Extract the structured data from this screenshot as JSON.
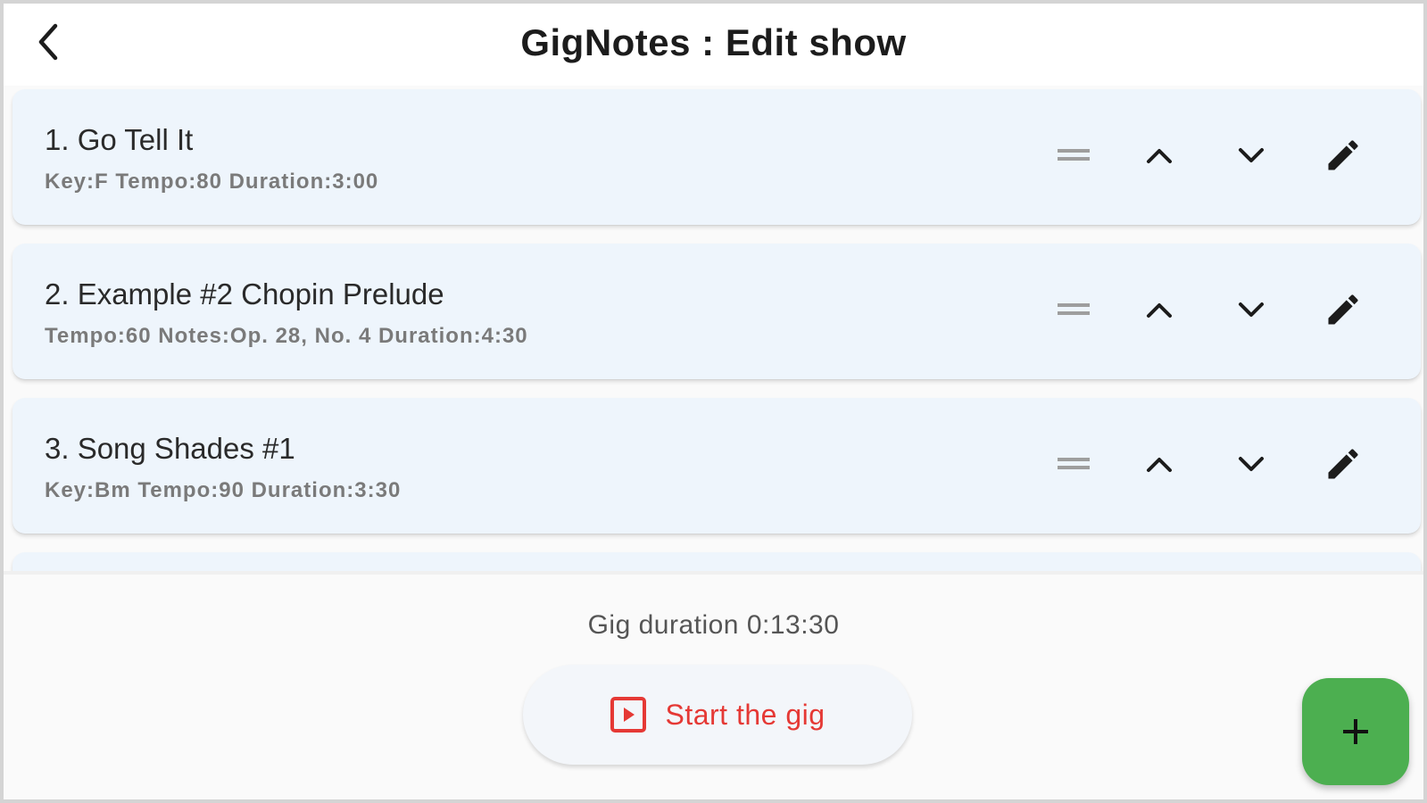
{
  "appbar": {
    "title": "GigNotes : Edit show"
  },
  "songs": [
    {
      "title": "1. Go Tell It",
      "details": "Key:F  Tempo:80  Duration:3:00"
    },
    {
      "title": "2. Example #2 Chopin Prelude",
      "details": "Tempo:60  Notes:Op. 28, No. 4  Duration:4:30"
    },
    {
      "title": "3. Song Shades #1",
      "details": "Key:Bm  Tempo:90  Duration:3:30"
    }
  ],
  "footer": {
    "gig_duration": "Gig duration 0:13:30",
    "start_label": "Start the gig"
  },
  "icons": {
    "back": "chevron-left-icon",
    "drag": "drag-handle-icon",
    "move_up": "chevron-up-icon",
    "move_down": "chevron-down-icon",
    "edit": "pencil-icon",
    "start": "play-box-icon",
    "add": "plus-icon"
  },
  "colors": {
    "card_background": "#eef5fc",
    "accent_red": "#e53935",
    "fab_green": "#4caf50"
  }
}
